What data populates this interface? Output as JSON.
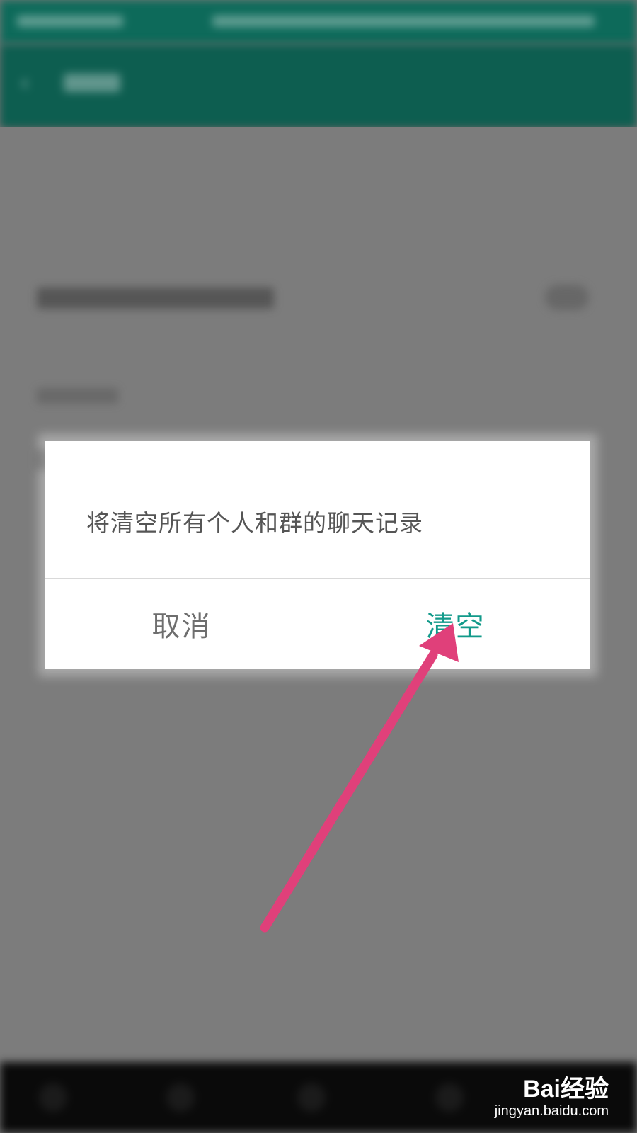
{
  "dialog": {
    "message": "将清空所有个人和群的聊天记录",
    "cancel_label": "取消",
    "confirm_label": "清空"
  },
  "colors": {
    "header": "#0d5e50",
    "accent": "#129a8a",
    "arrow": "#e0407a"
  },
  "watermark": {
    "logo": "Bai经验",
    "url": "jingyan.baidu.com"
  }
}
